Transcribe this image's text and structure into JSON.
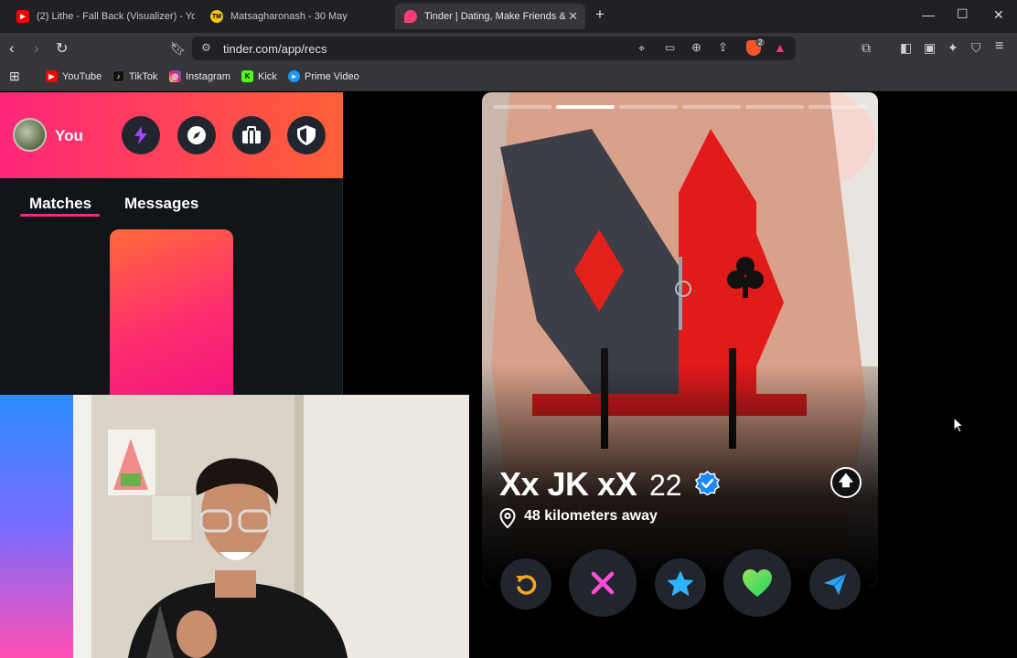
{
  "browser": {
    "tabs": [
      {
        "title": "(2) Lithe - Fall Back (Visualizer) - YouT",
        "icon": "youtube-icon",
        "active": false
      },
      {
        "title": "Matsagharonash - 30 May",
        "icon": "tm-icon",
        "active": false,
        "favicon_text": "TM"
      },
      {
        "title": "Tinder | Dating, Make Friends &",
        "icon": "tinder-icon",
        "active": true
      }
    ],
    "url": "tinder.com/app/recs",
    "bookmarks": [
      {
        "label": "YouTube",
        "icon": "youtube-icon",
        "color": "#ff0000"
      },
      {
        "label": "TikTok",
        "icon": "tiktok-icon",
        "color": "#111111"
      },
      {
        "label": "Instagram",
        "icon": "instagram-icon",
        "color": "#d6249f"
      },
      {
        "label": "Kick",
        "icon": "kick-icon",
        "color": "#53fc18",
        "glyph": "K"
      },
      {
        "label": "Prime Video",
        "icon": "prime-video-icon",
        "color": "#1a98ff"
      }
    ],
    "extension_badge": "2"
  },
  "sidebar": {
    "user_label": "You",
    "header_buttons": [
      "boost-icon",
      "explore-icon",
      "briefcase-icon",
      "safety-shield-icon"
    ],
    "tabs": [
      {
        "label": "Matches",
        "active": true
      },
      {
        "label": "Messages",
        "active": false
      }
    ]
  },
  "profile": {
    "name": "Xx JK xX",
    "age": "22",
    "verified": true,
    "distance": "48 kilometers away",
    "photo_count": 6,
    "current_photo": 2
  },
  "actions": [
    {
      "name": "rewind-button",
      "icon": "rewind-icon",
      "color": "#f5a623"
    },
    {
      "name": "nope-button",
      "icon": "close-icon",
      "color": "#ff4fd8"
    },
    {
      "name": "super-like-button",
      "icon": "star-icon",
      "color": "#2db3ff"
    },
    {
      "name": "like-button",
      "icon": "heart-icon",
      "color": "#4ce25a"
    },
    {
      "name": "send-message-button",
      "icon": "paper-plane-icon",
      "color": "#2ba6ff"
    }
  ],
  "colors": {
    "brand_gradient_start": "#fd267a",
    "brand_gradient_end": "#ff6036",
    "panel_bg": "#111418"
  }
}
